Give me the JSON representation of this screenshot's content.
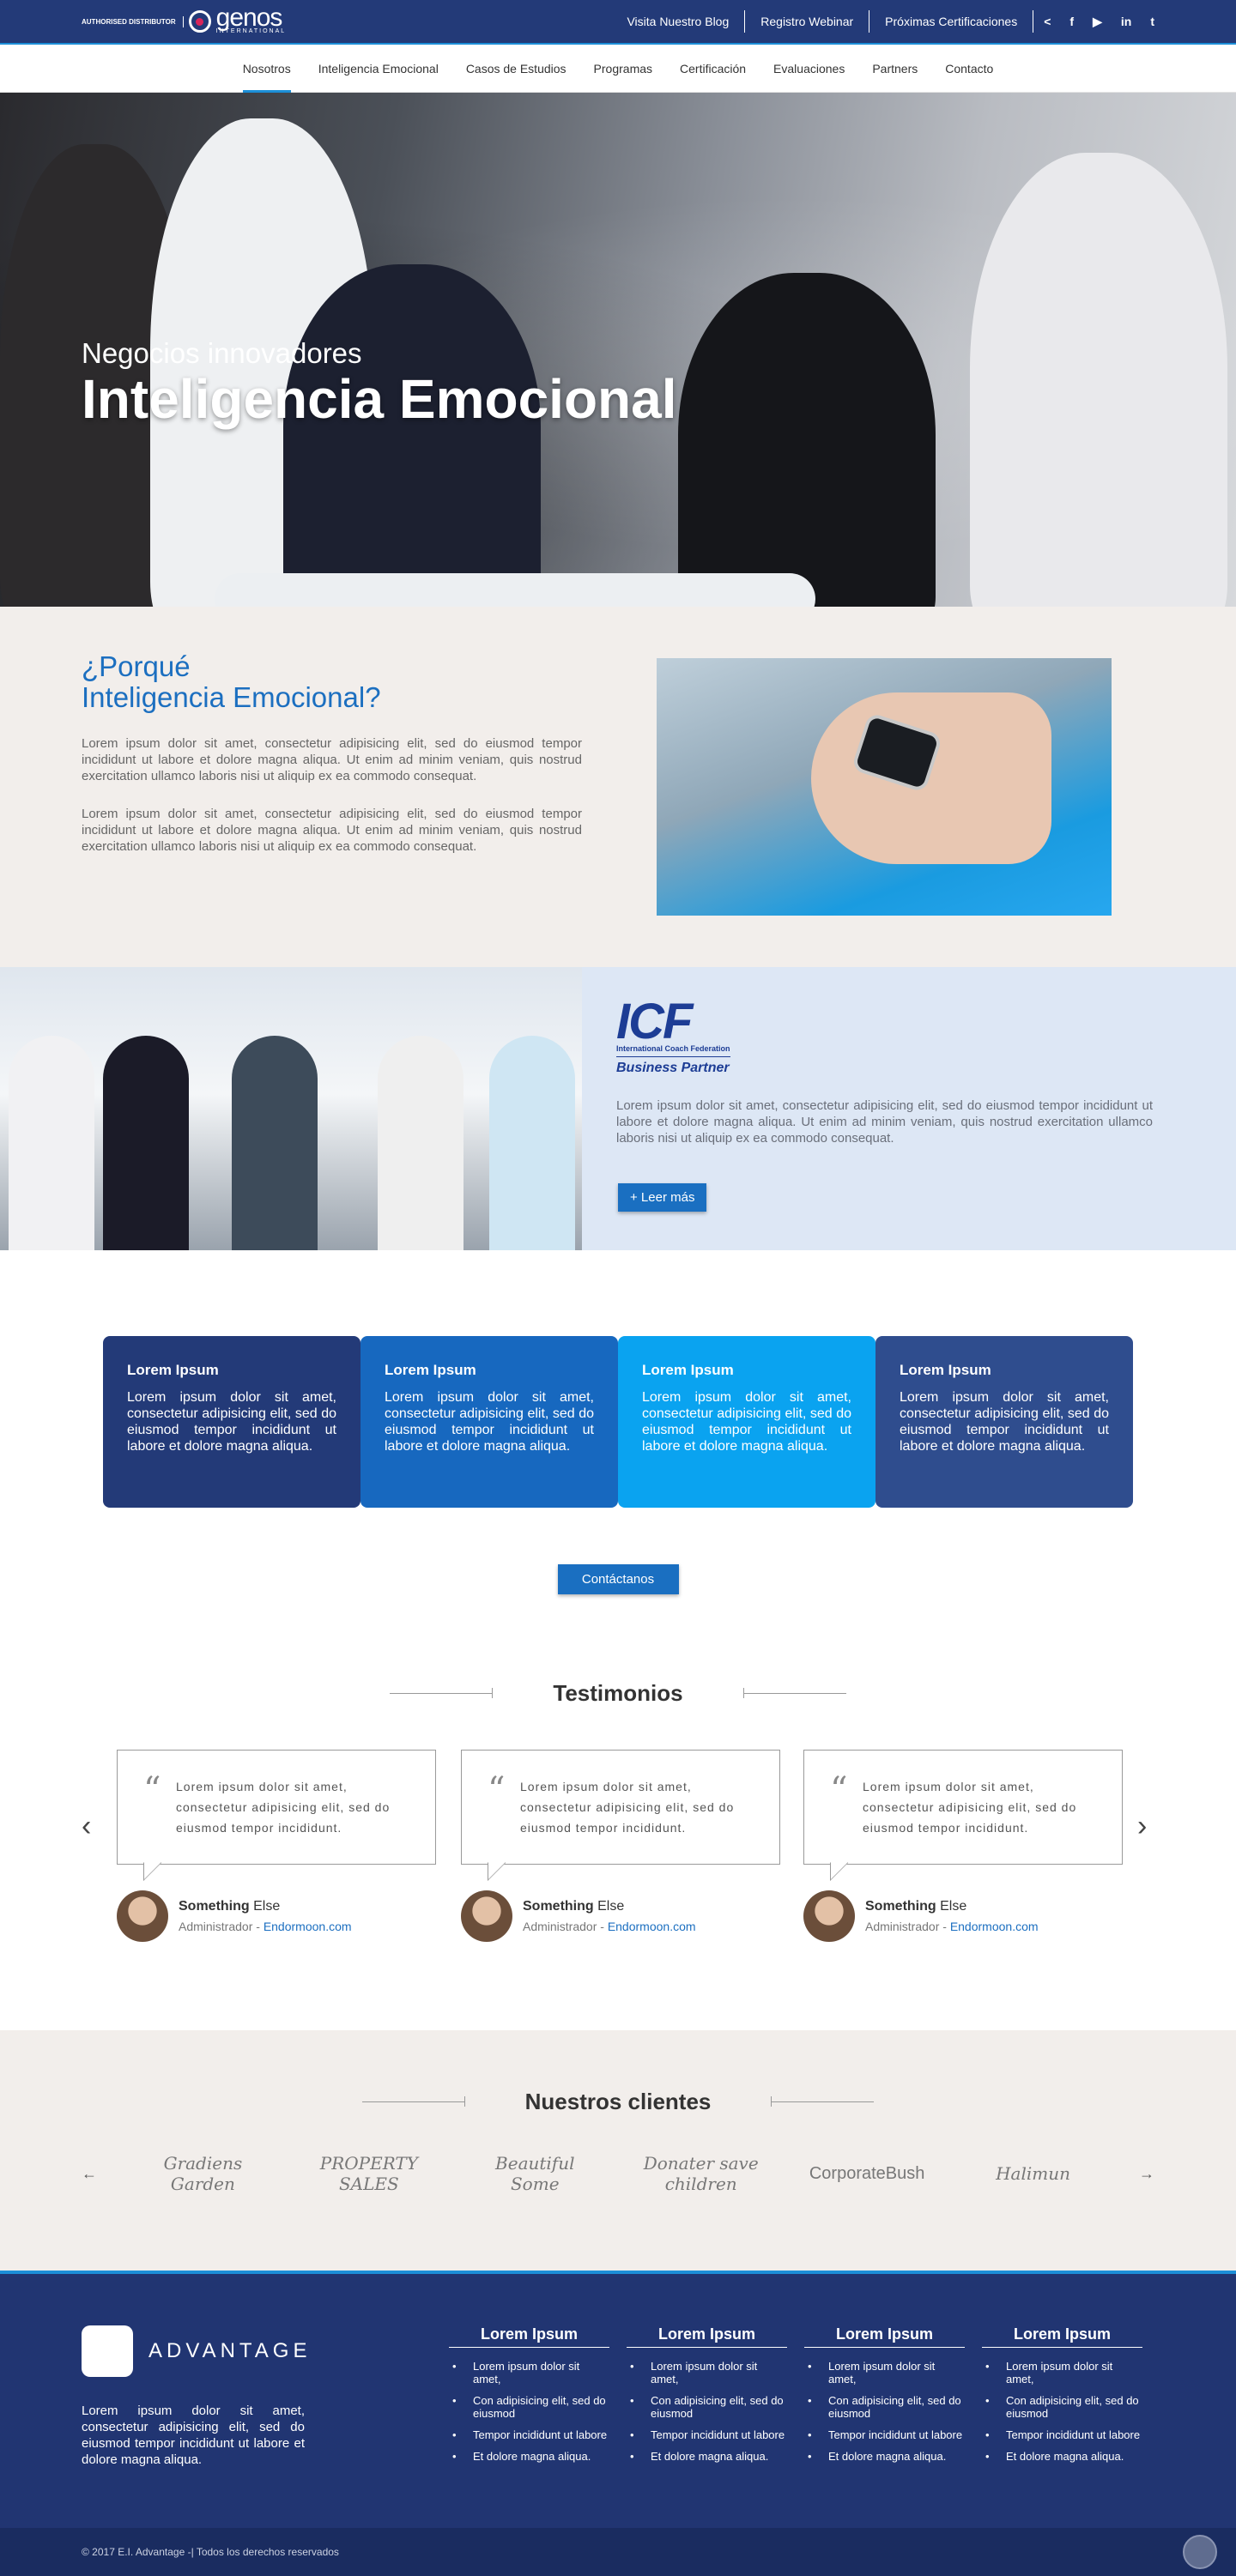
{
  "topbar": {
    "auth": "AUTHORISED DISTRIBUTOR",
    "brand": "genos",
    "brand_sub": "INTERNATIONAL",
    "links": [
      "Visita Nuestro Blog",
      "Registro Webinar",
      "Próximas Certificaciones"
    ]
  },
  "nav": [
    "Nosotros",
    "Inteligencia Emocional",
    "Casos de Estudios",
    "Programas",
    "Certificación",
    "Evaluaciones",
    "Partners",
    "Contacto"
  ],
  "hero": {
    "subtitle": "Negocios innovadores",
    "title": "Inteligencia Emocional"
  },
  "why": {
    "title1": "¿Porqué",
    "title2": "Inteligencia Emocional?",
    "p1": "Lorem ipsum dolor sit amet, consectetur adipisicing elit, sed do eiusmod tempor incididunt ut labore et dolore magna aliqua. Ut enim ad minim veniam, quis nostrud exercitation ullamco laboris nisi ut aliquip ex ea commodo consequat.",
    "p2": "Lorem ipsum dolor sit amet, consectetur adipisicing elit, sed do eiusmod tempor incididunt ut labore et dolore magna aliqua. Ut enim ad minim veniam, quis nostrud exercitation ullamco laboris nisi ut aliquip ex ea commodo consequat."
  },
  "icf": {
    "logo": "ICF",
    "logo_sub": "International Coach Federation",
    "partner": "Business Partner",
    "text": "Lorem ipsum dolor sit amet, consectetur adipisicing elit, sed do eiusmod tempor incididunt ut labore et dolore magna aliqua. Ut enim ad minim veniam, quis nostrud exercitation ullamco laboris nisi ut aliquip ex ea commodo consequat.",
    "button": "+ Leer más"
  },
  "cards": [
    {
      "title": "Lorem Ipsum",
      "text": "Lorem ipsum dolor sit amet, consectetur adipisicing elit, sed do eiusmod tempor incididunt ut labore et dolore magna aliqua.",
      "color": "#233a78"
    },
    {
      "title": "Lorem Ipsum",
      "text": "Lorem ipsum dolor sit amet, consectetur adipisicing elit, sed do eiusmod tempor incididunt ut labore et dolore magna aliqua.",
      "color": "#1768bf"
    },
    {
      "title": "Lorem Ipsum",
      "text": "Lorem ipsum dolor sit amet, consectetur adipisicing elit, sed do eiusmod tempor incididunt ut labore et dolore magna aliqua.",
      "color": "#0aa3f0"
    },
    {
      "title": "Lorem Ipsum",
      "text": "Lorem ipsum dolor sit amet, consectetur adipisicing elit, sed do eiusmod tempor incididunt ut labore et dolore magna aliqua.",
      "color": "#2f4d8e"
    }
  ],
  "contact_button": "Contáctanos",
  "testimonials": {
    "title": "Testimonios",
    "items": [
      {
        "quote": "Lorem ipsum dolor sit amet, consectetur adipisicing elit, sed do eiusmod tempor incididunt.",
        "name_bold": "Something",
        "name_rest": "Else",
        "role": "Administrador -",
        "site": "Endormoon.com"
      },
      {
        "quote": "Lorem ipsum dolor sit amet, consectetur adipisicing elit, sed do eiusmod tempor incididunt.",
        "name_bold": "Something",
        "name_rest": "Else",
        "role": "Administrador -",
        "site": "Endormoon.com"
      },
      {
        "quote": "Lorem ipsum dolor sit amet, consectetur adipisicing elit, sed do eiusmod tempor incididunt.",
        "name_bold": "Something",
        "name_rest": "Else",
        "role": "Administrador -",
        "site": "Endormoon.com"
      }
    ]
  },
  "clients": {
    "title": "Nuestros clientes",
    "logos": [
      "Gradiens Garden",
      "PROPERTY SALES",
      "Beautiful Some",
      "Donater save children",
      "CorporateBush",
      "Halimun"
    ]
  },
  "footer": {
    "brand": "ADVANTAGE",
    "text": "Lorem ipsum dolor sit amet, consectetur adipisicing elit, sed do eiusmod tempor incididunt ut labore et dolore magna aliqua.",
    "cols": [
      {
        "title": "Lorem Ipsum",
        "items": [
          "Lorem ipsum dolor sit amet,",
          "Con adipisicing elit, sed do eiusmod",
          "Tempor incididunt ut labore",
          "Et dolore magna aliqua."
        ]
      },
      {
        "title": "Lorem Ipsum",
        "items": [
          "Lorem ipsum dolor sit amet,",
          "Con adipisicing elit, sed do eiusmod",
          "Tempor incididunt ut labore",
          "Et dolore magna aliqua."
        ]
      },
      {
        "title": "Lorem Ipsum",
        "items": [
          "Lorem ipsum dolor sit amet,",
          "Con adipisicing elit, sed do eiusmod",
          "Tempor incididunt ut labore",
          "Et dolore magna aliqua."
        ]
      },
      {
        "title": "Lorem Ipsum",
        "items": [
          "Lorem ipsum dolor sit amet,",
          "Con adipisicing elit, sed do eiusmod",
          "Tempor incididunt ut labore",
          "Et dolore magna aliqua."
        ]
      }
    ],
    "copyright": "© 2017 E.I. Advantage -| Todos los derechos reservados"
  }
}
